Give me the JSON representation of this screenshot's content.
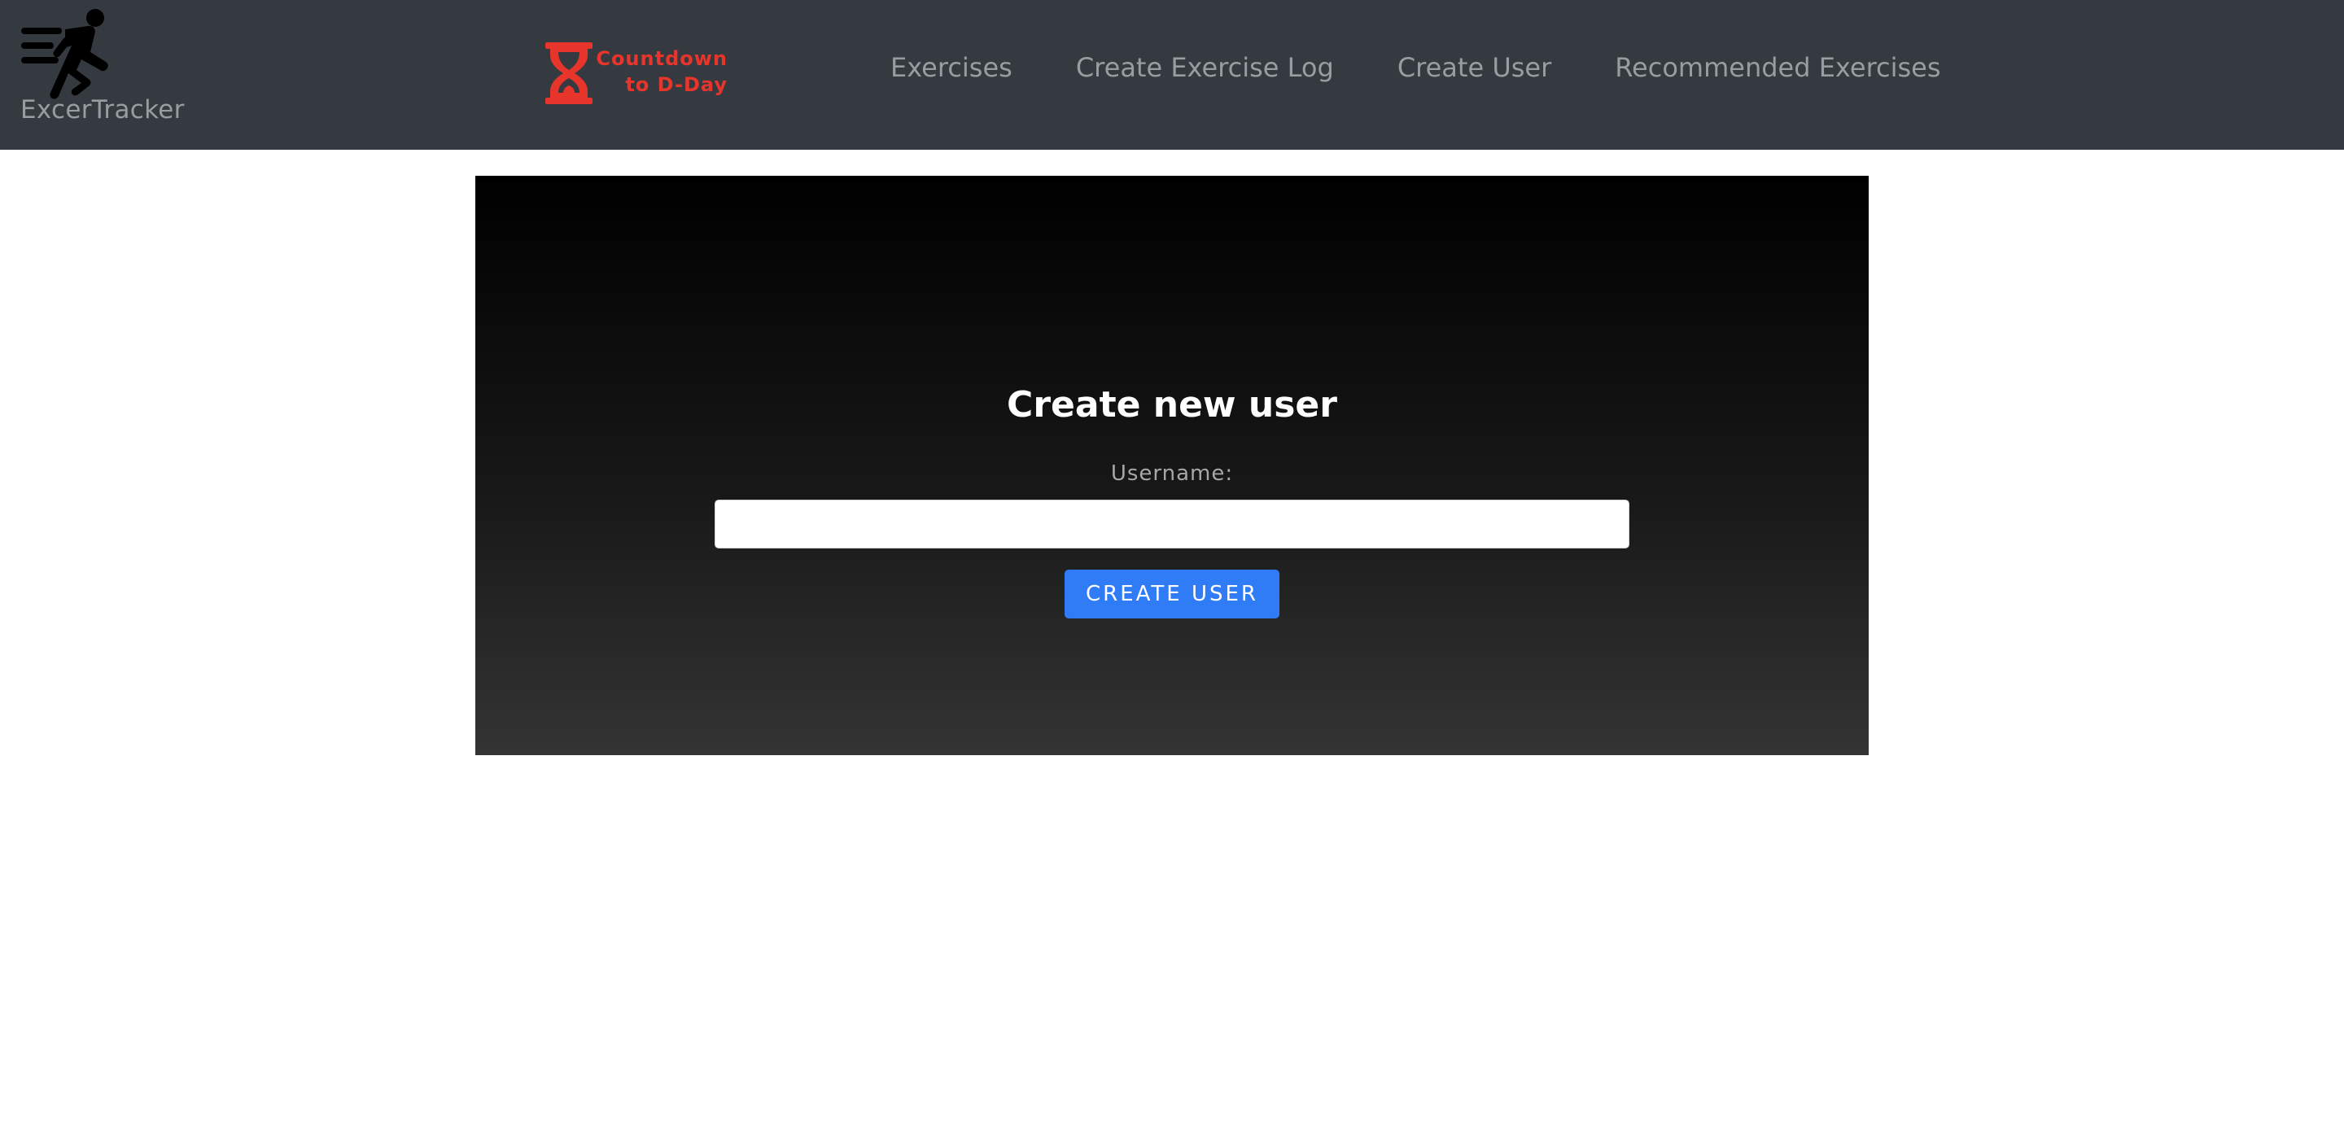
{
  "navbar": {
    "brand": {
      "icon": "running-person-icon",
      "label": "ExcerTracker"
    },
    "countdown": {
      "icon": "hourglass-icon",
      "line1": "Countdown",
      "line2": "to D-Day",
      "color": "#e8352b"
    },
    "links": [
      {
        "label": "Exercises"
      },
      {
        "label": "Create Exercise Log"
      },
      {
        "label": "Create User"
      },
      {
        "label": "Recommended Exercises"
      }
    ],
    "background": "#343a40"
  },
  "form": {
    "title": "Create new user",
    "username_label": "Username:",
    "username_value": "",
    "submit_label": "CREATE USER",
    "submit_color": "#2f7cf6"
  }
}
